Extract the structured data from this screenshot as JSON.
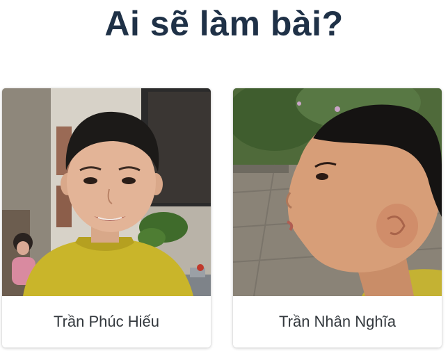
{
  "page": {
    "title": "Ai sẽ làm bài?"
  },
  "students": [
    {
      "name": "Trần Phúc Hiếu"
    },
    {
      "name": "Trần Nhân Nghĩa"
    }
  ],
  "colors": {
    "title": "#1f3147",
    "name_text": "#33383d",
    "card_bg": "#ffffff"
  }
}
